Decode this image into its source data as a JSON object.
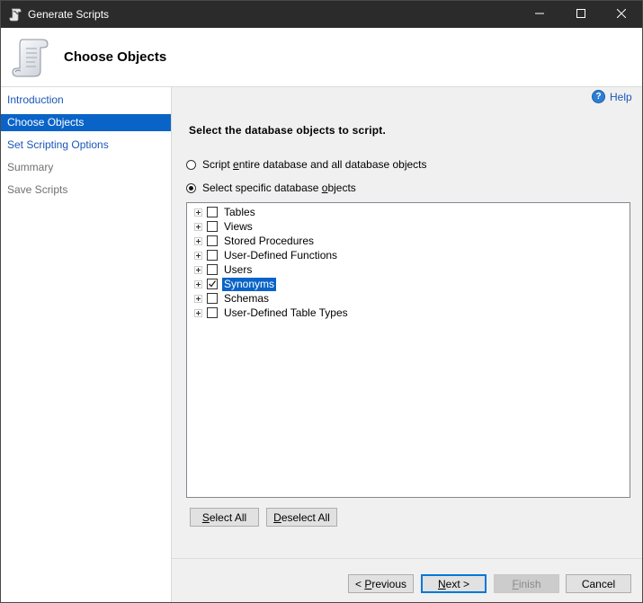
{
  "window": {
    "title": "Generate Scripts",
    "icon": "script-scroll-icon"
  },
  "header": {
    "title": "Choose Objects",
    "icon": "scroll-icon"
  },
  "nav": {
    "items": [
      {
        "label": "Introduction",
        "state": "link"
      },
      {
        "label": "Choose Objects",
        "state": "active"
      },
      {
        "label": "Set Scripting Options",
        "state": "link"
      },
      {
        "label": "Summary",
        "state": "disabled"
      },
      {
        "label": "Save Scripts",
        "state": "disabled"
      }
    ]
  },
  "main": {
    "help_label": "Help",
    "instruction": "Select the database objects to script.",
    "radio_entire": {
      "before": "Script ",
      "mnemonic": "e",
      "after": "ntire database and all database objects",
      "checked": false
    },
    "radio_specific": {
      "before": "Select specific database ",
      "mnemonic": "o",
      "after": "bjects",
      "checked": true
    },
    "tree_items": [
      {
        "label": "Tables",
        "checked": false
      },
      {
        "label": "Views",
        "checked": false
      },
      {
        "label": "Stored Procedures",
        "checked": false
      },
      {
        "label": "User-Defined Functions",
        "checked": false
      },
      {
        "label": "Users",
        "checked": false
      },
      {
        "label": "Synonyms",
        "checked": true,
        "selected": true
      },
      {
        "label": "Schemas",
        "checked": false
      },
      {
        "label": "User-Defined Table Types",
        "checked": false
      }
    ],
    "select_all": {
      "mnemonic": "S",
      "rest": "elect All"
    },
    "deselect_all": {
      "mnemonic": "D",
      "rest": "eselect All"
    }
  },
  "footer": {
    "previous": {
      "before": "< ",
      "mnemonic": "P",
      "after": "revious"
    },
    "next": {
      "mnemonic": "N",
      "after": "ext >"
    },
    "finish": {
      "mnemonic": "F",
      "after": "inish"
    },
    "cancel": "Cancel"
  },
  "colors": {
    "accent": "#0a64c8",
    "link": "#1a57b8",
    "titlebar": "#2b2b2b"
  }
}
